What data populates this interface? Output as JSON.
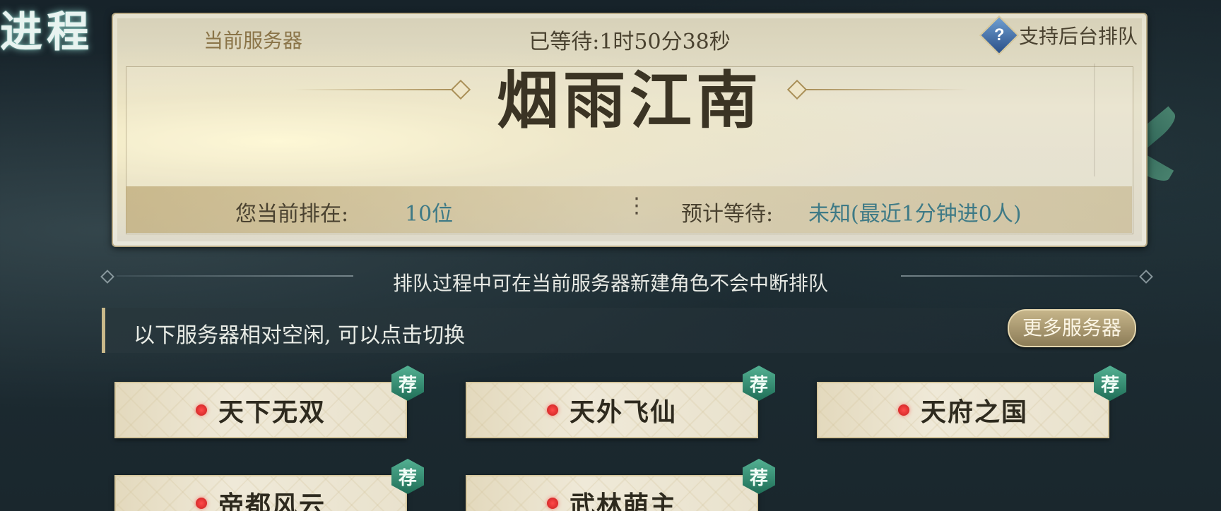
{
  "corner_title": "进程",
  "header": {
    "current_server_label": "当前服务器",
    "waited_label": "已等待:",
    "waited_value": "1时50分38秒",
    "background_queue_label": "支持后台排队",
    "help_icon": "question-diamond-icon"
  },
  "server": {
    "name": "烟雨江南"
  },
  "status": {
    "rank_label": "您当前排在:",
    "rank_value": "10位",
    "separator": "⋮",
    "eta_label": "预计等待:",
    "eta_value": "未知(最近1分钟进0人)"
  },
  "notice": "排队过程中可在当前服务器新建角色不会中断排队",
  "suggestions": {
    "text": "以下服务器相对空闲, 可以点击切换",
    "more_button": "更多服务器",
    "badge": "荐",
    "servers": [
      {
        "name": "天下无双"
      },
      {
        "name": "天外飞仙"
      },
      {
        "name": "天府之国"
      },
      {
        "name": "帝都风云"
      },
      {
        "name": "武林萌主"
      }
    ]
  },
  "colors": {
    "accent_teal": "#3e7a86",
    "status_dot_red": "#e23333",
    "badge_green": "#2f8a6e"
  }
}
